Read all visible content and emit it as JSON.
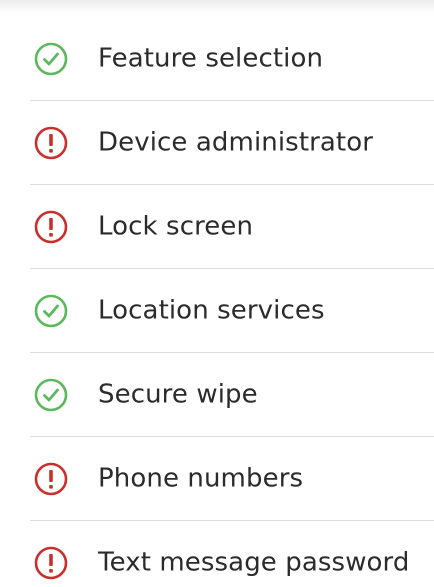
{
  "colors": {
    "ok": "#5cb85c",
    "error": "#c9302c",
    "text": "#2b2b2b",
    "divider": "#dcdcdc"
  },
  "checklist": [
    {
      "label": "Feature selection",
      "status": "ok",
      "icon": "check-circle-icon"
    },
    {
      "label": "Device administrator",
      "status": "error",
      "icon": "exclamation-circle-icon"
    },
    {
      "label": "Lock screen",
      "status": "error",
      "icon": "exclamation-circle-icon"
    },
    {
      "label": "Location services",
      "status": "ok",
      "icon": "check-circle-icon"
    },
    {
      "label": "Secure wipe",
      "status": "ok",
      "icon": "check-circle-icon"
    },
    {
      "label": "Phone numbers",
      "status": "error",
      "icon": "exclamation-circle-icon"
    },
    {
      "label": "Text message password",
      "status": "error",
      "icon": "exclamation-circle-icon"
    }
  ]
}
